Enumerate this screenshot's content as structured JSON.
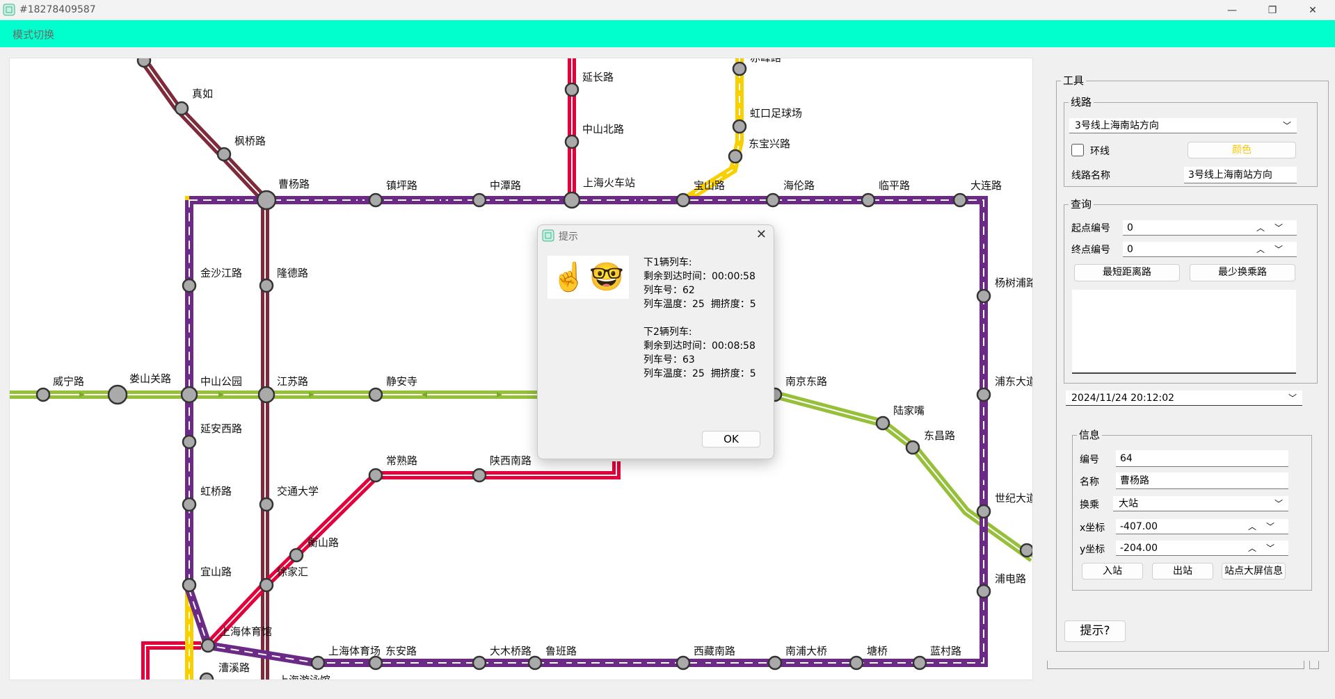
{
  "window": {
    "title": "#18278409587",
    "minimize": "—",
    "restore": "❐",
    "close": "✕"
  },
  "menubar": {
    "mode_switch": "模式切换"
  },
  "map": {
    "stations": [
      {
        "name": "真如"
      },
      {
        "name": "枫桥路"
      },
      {
        "name": "曹杨路"
      },
      {
        "name": "镇坪路"
      },
      {
        "name": "中潭路"
      },
      {
        "name": "上海火车站"
      },
      {
        "name": "宝山路"
      },
      {
        "name": "海伦路"
      },
      {
        "name": "临平路"
      },
      {
        "name": "大连路"
      },
      {
        "name": "延长路"
      },
      {
        "name": "中山北路"
      },
      {
        "name": "赤峰路"
      },
      {
        "name": "虹口足球场"
      },
      {
        "name": "东宝兴路"
      },
      {
        "name": "金沙江路"
      },
      {
        "name": "隆德路"
      },
      {
        "name": "杨树浦路"
      },
      {
        "name": "威宁路"
      },
      {
        "name": "娄山关路"
      },
      {
        "name": "中山公园"
      },
      {
        "name": "江苏路"
      },
      {
        "name": "静安寺"
      },
      {
        "name": "南京东路"
      },
      {
        "name": "浦东大道"
      },
      {
        "name": "陆家嘴"
      },
      {
        "name": "东昌路"
      },
      {
        "name": "延安西路"
      },
      {
        "name": "常熟路"
      },
      {
        "name": "陕西南路"
      },
      {
        "name": "虹桥路"
      },
      {
        "name": "交通大学"
      },
      {
        "name": "世纪大道"
      },
      {
        "name": "衡山路"
      },
      {
        "name": "宜山路"
      },
      {
        "name": "徐家汇"
      },
      {
        "name": "浦电路"
      },
      {
        "name": "上海体育馆"
      },
      {
        "name": "上海体育场"
      },
      {
        "name": "东安路"
      },
      {
        "name": "大木桥路"
      },
      {
        "name": "鲁班路"
      },
      {
        "name": "西藏南路"
      },
      {
        "name": "南浦大桥"
      },
      {
        "name": "塘桥"
      },
      {
        "name": "蓝村路"
      },
      {
        "name": "漕溪路"
      },
      {
        "name": "上海游泳馆"
      }
    ],
    "colors": {
      "line1": "#e4003a",
      "line2": "#97c03a",
      "line3": "#f8d000",
      "line4": "#6b2a86",
      "line11": "#7e2a3b"
    }
  },
  "tools": {
    "legend": "工具",
    "route_group": "线路",
    "route_selected": "3号线上海南站方向",
    "loop_label": "环线",
    "color_button": "颜色",
    "route_name_label": "线路名称",
    "route_name_value": "3号线上海南站方向",
    "query_group": "查询",
    "start_label": "起点编号",
    "start_value": "0",
    "end_label": "终点编号",
    "end_value": "0",
    "shortest_button": "最短距离路",
    "least_transfer_button": "最少换乘路",
    "datetime": "2024/11/24 20:12:02",
    "info_group": "信息",
    "id_label": "编号",
    "id_value": "64",
    "name_label": "名称",
    "name_value": "曹杨路",
    "transfer_label": "换乘",
    "transfer_value": "大站",
    "x_label": "x坐标",
    "x_value": "-407.00",
    "y_label": "y坐标",
    "y_value": "-204.00",
    "enter_button": "入站",
    "exit_button": "出站",
    "screen_button": "站点大屏信息",
    "hint_button": "提示?"
  },
  "dialog": {
    "title": "提示",
    "message": "下1辆列车:\n剩余到达时间：00:00:58\n列车号：62\n列车温度：25  拥挤度：5\n\n下2辆列车:\n剩余到达时间：00:08:58\n列车号：63\n列车温度：25  拥挤度：5",
    "emoji1": "☝️",
    "emoji2": "🤓",
    "ok": "OK"
  }
}
